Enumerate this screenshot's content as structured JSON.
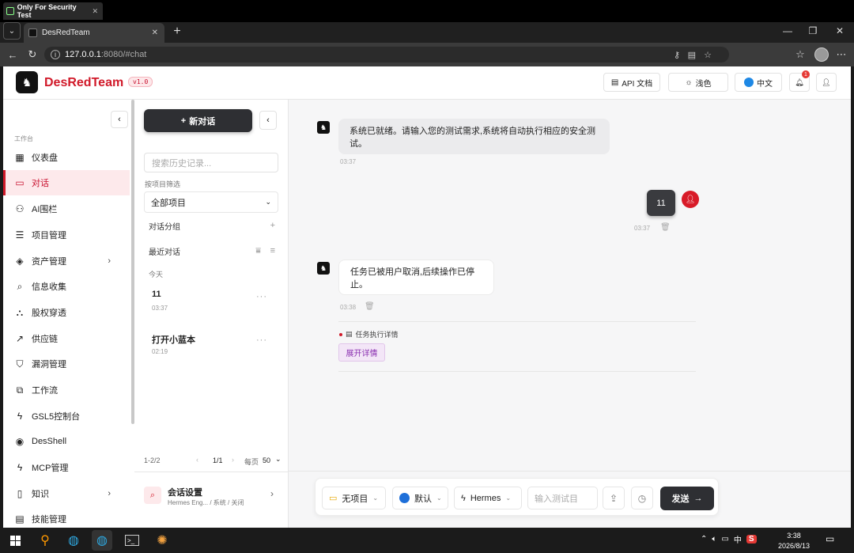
{
  "os": {
    "ext_tab": "Only For Security Test",
    "taskbar_time": "3:38",
    "taskbar_date": "2026/8/13",
    "ime": "中"
  },
  "browser": {
    "tab_title": "DesRedTeam",
    "url_host": "127.0.0.1",
    "url_rest": ":8080/#chat"
  },
  "header": {
    "brand": "DesRedTeam",
    "version": "v1.0",
    "api_docs": "API 文档",
    "theme": "浅色",
    "lang": "中文",
    "notif_count": "1"
  },
  "sidebar": {
    "group": "工作台",
    "items": [
      {
        "label": "仪表盘",
        "icon": "dashboard-icon"
      },
      {
        "label": "对话",
        "icon": "chat-icon"
      },
      {
        "label": "AI围栏",
        "icon": "user-shield-icon"
      },
      {
        "label": "项目管理",
        "icon": "list-icon"
      },
      {
        "label": "资产管理",
        "icon": "layers-icon"
      },
      {
        "label": "信息收集",
        "icon": "search-icon"
      },
      {
        "label": "股权穿透",
        "icon": "org-tree-icon"
      },
      {
        "label": "供应链",
        "icon": "trend-icon"
      },
      {
        "label": "漏洞管理",
        "icon": "shield-icon"
      },
      {
        "label": "工作流",
        "icon": "workflow-icon"
      },
      {
        "label": "GSL5控制台",
        "icon": "bolt-icon"
      },
      {
        "label": "DesShell",
        "icon": "radio-icon"
      },
      {
        "label": "MCP管理",
        "icon": "bolt-icon"
      },
      {
        "label": "知识",
        "icon": "book-icon"
      },
      {
        "label": "技能管理",
        "icon": "doc-icon"
      }
    ]
  },
  "conv": {
    "new_chat": "新对话",
    "search_placeholder": "搜索历史记录...",
    "filter_label": "按项目筛选",
    "project_value": "全部项目",
    "groups_label": "对话分组",
    "recent_label": "最近对话",
    "today": "今天",
    "items": [
      {
        "title": "11",
        "time": "03:37"
      },
      {
        "title": "打开小蓝本",
        "time": "02:19"
      }
    ],
    "pager_range": "1-2/2",
    "pager_page": "1/1",
    "per_page_label": "每页",
    "per_page": "50",
    "settings_title": "会话设置",
    "settings_sub": "Hermes Eng... / 系统 / 关闭"
  },
  "chat": {
    "msg1": "系统已就绪。请输入您的测试需求,系统将自动执行相应的安全测试。",
    "msg1_time": "03:37",
    "user_msg": "11",
    "user_time": "03:37",
    "msg2": "任务已被用户取消,后续操作已停止。",
    "msg2_time": "03:38",
    "detail_label": "任务执行详情",
    "expand_btn": "展开详情"
  },
  "input": {
    "project": "无项目",
    "mode": "默认",
    "agent": "Hermes",
    "placeholder": "输入测试目",
    "send": "发送"
  }
}
